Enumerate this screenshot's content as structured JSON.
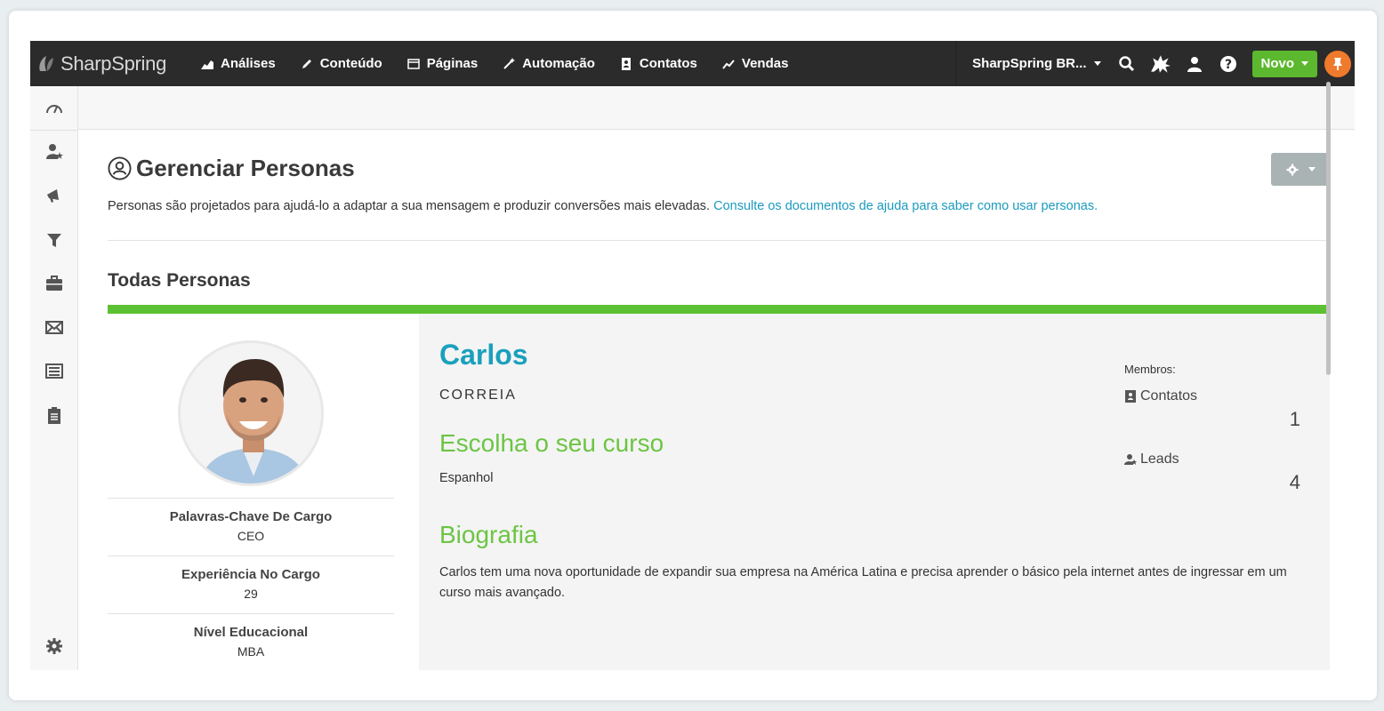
{
  "brand": {
    "name": "SharpSpring"
  },
  "nav": [
    {
      "label": "Análises",
      "icon": "area-chart-icon"
    },
    {
      "label": "Conteúdo",
      "icon": "pencil-icon"
    },
    {
      "label": "Páginas",
      "icon": "window-icon"
    },
    {
      "label": "Automação",
      "icon": "magic-wand-icon"
    },
    {
      "label": "Contatos",
      "icon": "address-book-icon"
    },
    {
      "label": "Vendas",
      "icon": "line-chart-icon"
    }
  ],
  "topright": {
    "account": "SharpSpring BR...",
    "novo_label": "Novo"
  },
  "page": {
    "title": "Gerenciar Personas",
    "description": "Personas são projetados para ajudá-lo a adaptar a sua mensagem e produzir conversões mais elevadas. ",
    "help_link": "Consulte os documentos de ajuda para saber como usar personas.",
    "section_title": "Todas Personas"
  },
  "persona": {
    "first_name": "Carlos",
    "last_name": "CORREIA",
    "course_heading": "Escolha o seu curso",
    "course_value": "Espanhol",
    "bio_heading": "Biografia",
    "bio_text": "Carlos tem uma nova oportunidade de expandir sua empresa na América Latina e precisa aprender o básico pela internet antes de ingressar em um curso mais avançado.",
    "attributes": [
      {
        "label": "Palavras-Chave De Cargo",
        "value": "CEO"
      },
      {
        "label": "Experiência No Cargo",
        "value": "29"
      },
      {
        "label": "Nível Educacional",
        "value": "MBA"
      }
    ],
    "members": {
      "label": "Membros:",
      "contacts_label": "Contatos",
      "contacts_count": "1",
      "leads_label": "Leads",
      "leads_count": "4"
    }
  },
  "colors": {
    "topbar": "#2b2b2b",
    "accent_green": "#5cc132",
    "link_blue": "#1a9bbf",
    "pin_orange": "#f07a2b"
  }
}
